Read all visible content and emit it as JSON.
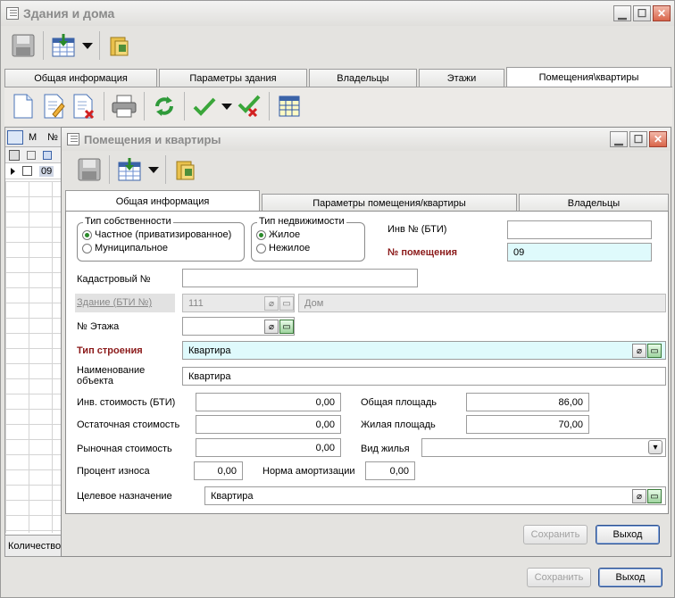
{
  "outer": {
    "title": "Здания и дома",
    "tabs": [
      "Общая информация",
      "Параметры здания",
      "Владельцы",
      "Этажи",
      "Помещения\\квартиры"
    ],
    "grid": {
      "col_m": "М",
      "col_n": "№",
      "row_value": "09",
      "footer": "Количество"
    },
    "save_label": "Сохранить",
    "exit_label": "Выход"
  },
  "inner": {
    "title": "Помещения и квартиры",
    "tabs": [
      "Общая информация",
      "Параметры помещения/квартиры",
      "Владельцы"
    ],
    "ownership": {
      "title": "Тип собственности",
      "options": [
        "Частное (приватизированное)",
        "Муниципальное"
      ],
      "selected": 0
    },
    "property": {
      "title": "Тип недвижимости",
      "options": [
        "Жилое",
        "Нежилое"
      ],
      "selected": 0
    },
    "fields": {
      "inv_bti_label": "Инв № (БТИ)",
      "inv_bti_value": "",
      "room_no_label": "№ помещения",
      "room_no_value": "09",
      "cadastral_label": "Кадастровый №",
      "cadastral_value": "",
      "building_label": "Здание (БТИ №)",
      "building_no": "111",
      "building_name": "Дом",
      "floor_label": "№ Этажа",
      "floor_value": "",
      "build_type_label": "Тип строения",
      "build_type_value": "Квартира",
      "object_name_label": "Наименование объекта",
      "object_name_value": "Квартира",
      "inv_cost_label": "Инв. стоимость (БТИ)",
      "inv_cost_value": "0,00",
      "residual_label": "Остаточная стоимость",
      "residual_value": "0,00",
      "market_label": "Рыночная стоимость",
      "market_value": "0,00",
      "wear_label": "Процент износа",
      "wear_value": "0,00",
      "amort_label": "Норма амортизации",
      "amort_value": "0,00",
      "total_area_label": "Общая площадь",
      "total_area_value": "86,00",
      "living_area_label": "Жилая площадь",
      "living_area_value": "70,00",
      "housing_type_label": "Вид жилья",
      "housing_type_value": "",
      "purpose_label": "Целевое назначение",
      "purpose_value": "Квартира"
    },
    "save_label": "Сохранить",
    "exit_label": "Выход"
  }
}
